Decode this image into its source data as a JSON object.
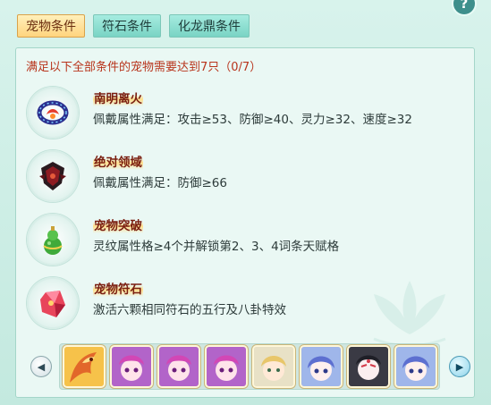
{
  "tabs": [
    {
      "label": "宠物条件",
      "active": true
    },
    {
      "label": "符石条件",
      "active": false
    },
    {
      "label": "化龙鼎条件",
      "active": false
    }
  ],
  "help_label": "?",
  "requirement_text": "满足以下全部条件的宠物需要达到7只（0/7）",
  "conditions": [
    {
      "title": "南明离火",
      "desc": "佩戴属性满足：攻击≥53、防御≥40、灵力≥32、速度≥32",
      "icon": "ring-artifact-icon"
    },
    {
      "title": "绝对领域",
      "desc": "佩戴属性满足：防御≥66",
      "icon": "dark-shield-artifact-icon"
    },
    {
      "title": "宠物突破",
      "desc": "灵纹属性格≥4个并解锁第2、3、4词条天赋格",
      "icon": "green-gourd-icon"
    },
    {
      "title": "宠物符石",
      "desc": "激活六颗相同符石的五行及八卦特效",
      "icon": "red-crystal-icon"
    }
  ],
  "pets": [
    {
      "name": "phoenix-pet"
    },
    {
      "name": "pink-hair-pet"
    },
    {
      "name": "pink-hair-pet"
    },
    {
      "name": "pink-hair-pet"
    },
    {
      "name": "blonde-pet"
    },
    {
      "name": "blue-hair-pet"
    },
    {
      "name": "masked-pet"
    },
    {
      "name": "blue-hair-pet"
    }
  ],
  "colors": {
    "accent": "#b8341c",
    "title": "#7a1e10",
    "tab_active": "#ffd47e",
    "tab": "#79d4c4"
  }
}
